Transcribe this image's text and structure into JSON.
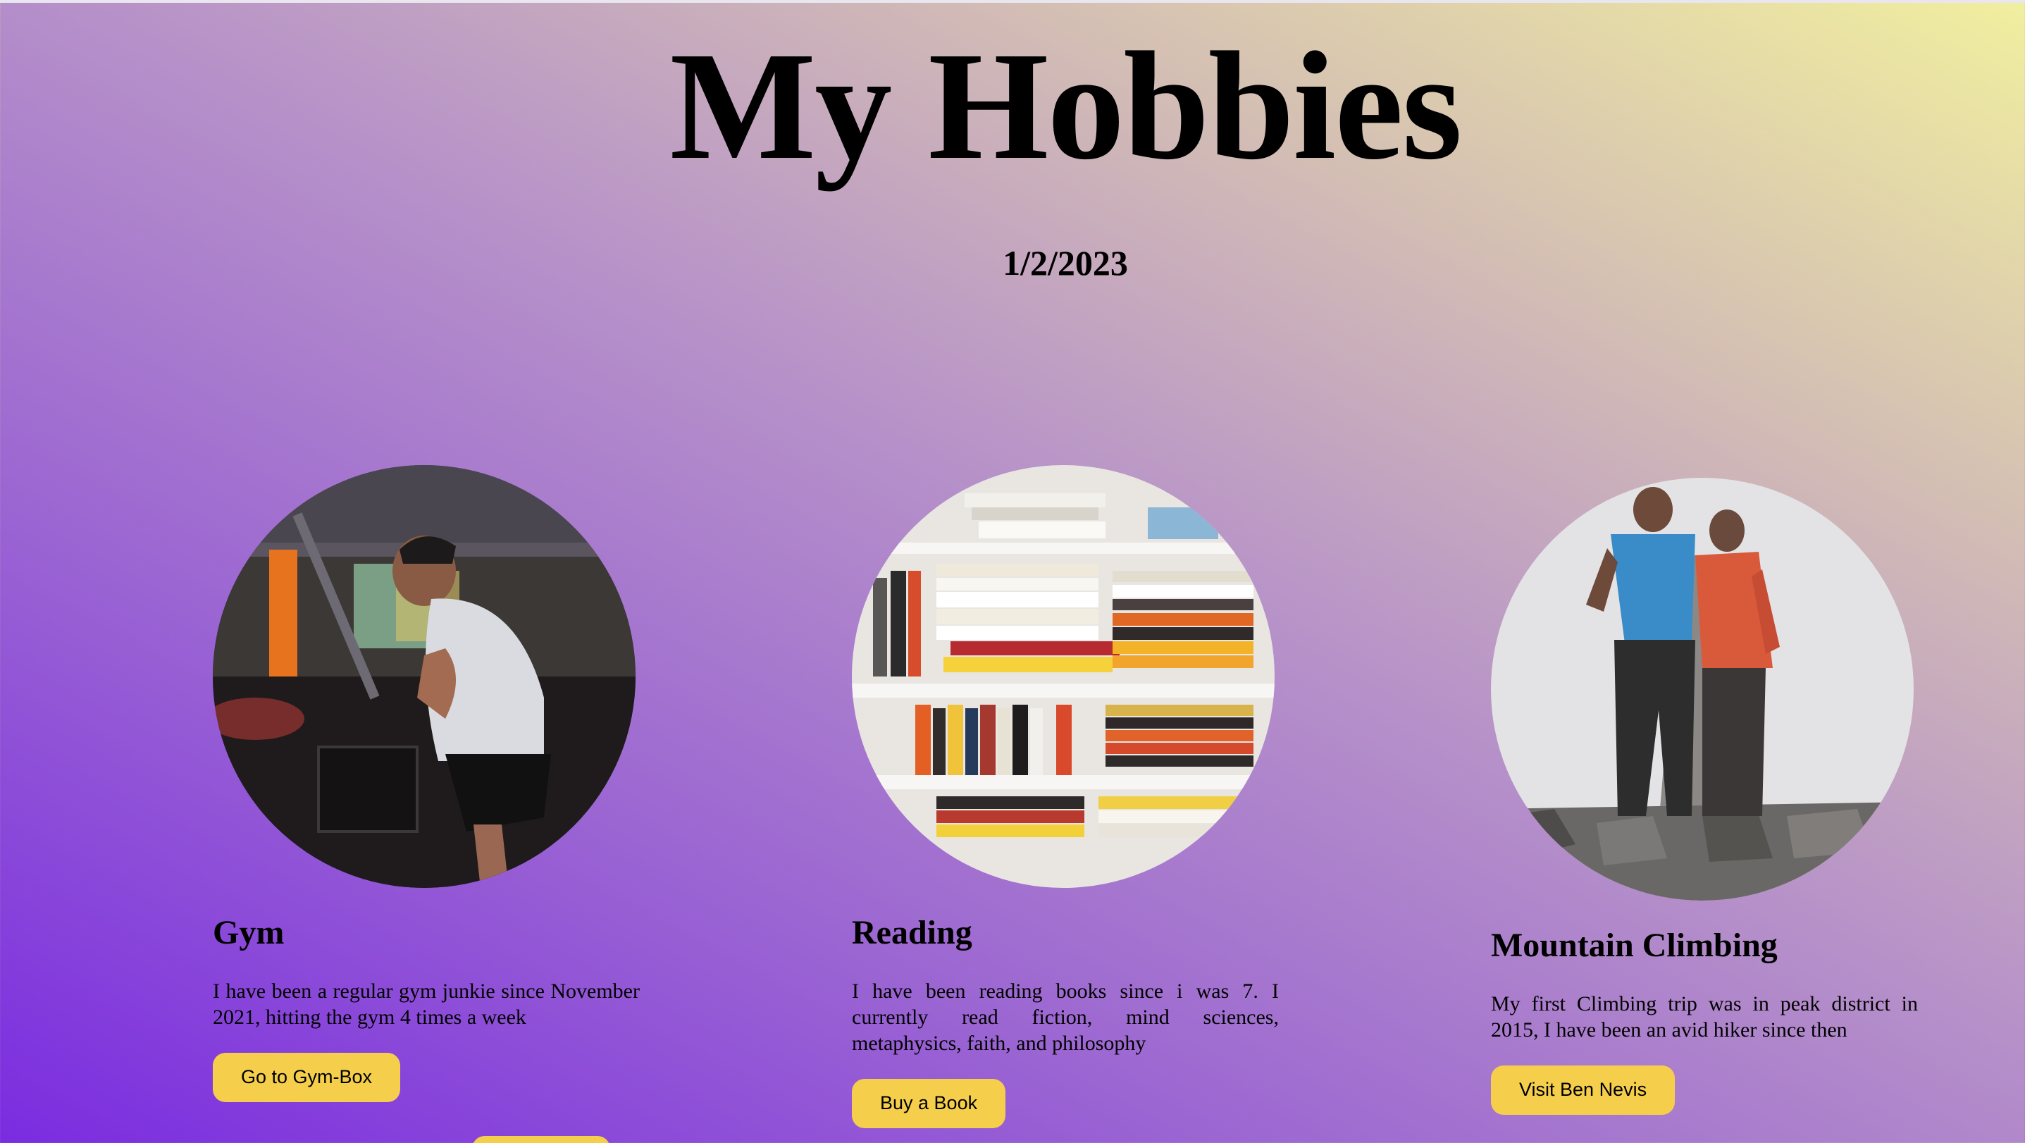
{
  "page": {
    "title": "My Hobbies",
    "date": "1/2/2023"
  },
  "hobbies": [
    {
      "title": "Gym",
      "description": "I have been a regular gym junkie since November 2021, hitting the gym 4 times a week",
      "button_label": "Go to Gym-Box",
      "photo_subject": "man-at-cable-machine-in-gym"
    },
    {
      "title": "Reading",
      "description": "I have been reading books since i was 7. I currently read fiction, mind sciences, metaphysics, faith, and philosophy",
      "button_label": "Buy a Book",
      "photo_subject": "bookshelf-full-of-books"
    },
    {
      "title": "Mountain Climbing",
      "description": "My first Climbing trip was in peak district in 2015, I have been an avid hiker since then",
      "button_label": "Visit Ben Nevis",
      "photo_subject": "two-hikers-at-summit-cairn-in-fog"
    }
  ],
  "colors": {
    "button": "#f5cf4c",
    "gradient_start": "#7a2ce0",
    "gradient_end": "#f1ef9f"
  }
}
